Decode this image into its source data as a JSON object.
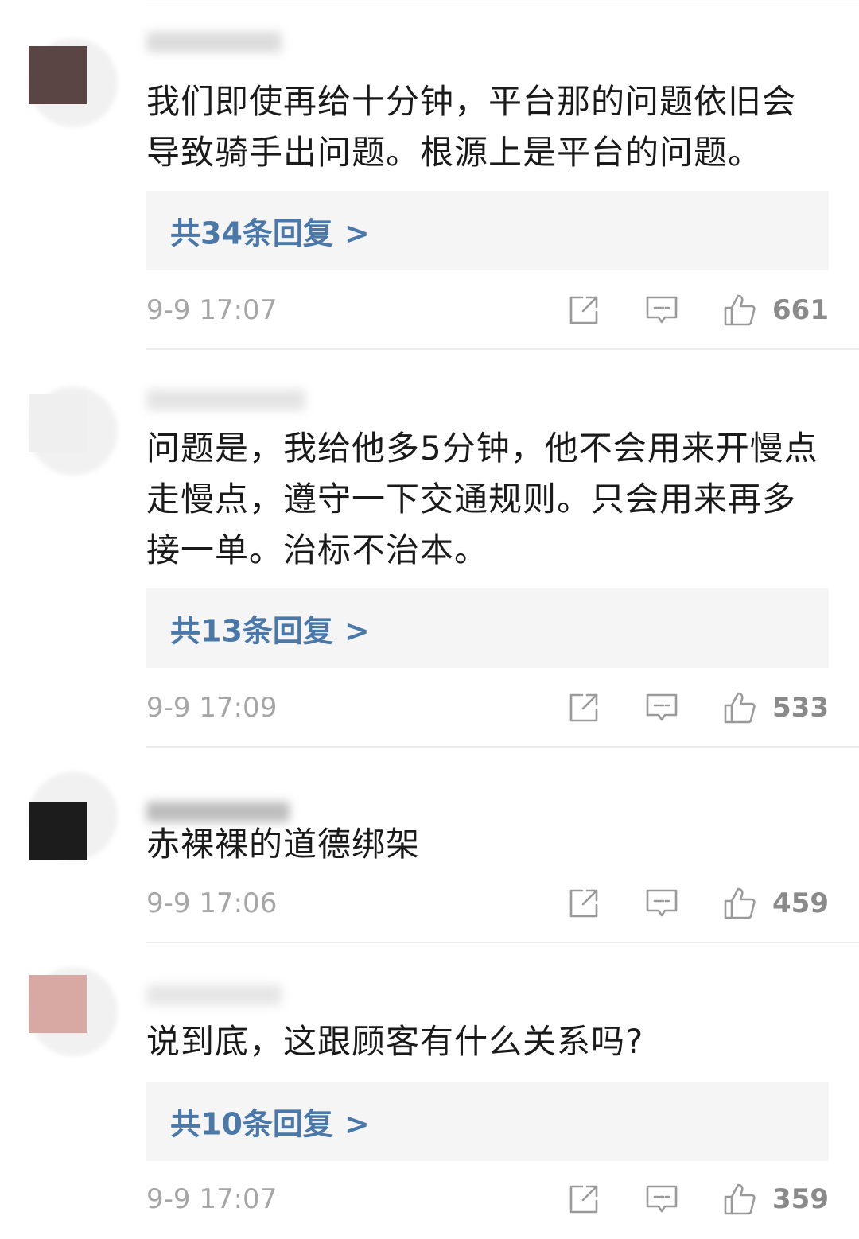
{
  "comments": [
    {
      "text": "我们即使再给十分钟，平台那的问题依旧会导致骑手出问题。根源上是平台的问题。",
      "reply": "共34条回复",
      "reply_arrow": ">",
      "time": "9-9 17:07",
      "likes": "661",
      "avatar_color": "#5a4444"
    },
    {
      "text": "问题是，我给他多5分钟，他不会用来开慢点走慢点，遵守一下交通规则。只会用来再多接一单。治标不治本。",
      "reply": "共13条回复",
      "reply_arrow": ">",
      "time": "9-9 17:09",
      "likes": "533",
      "avatar_color": "#efefef"
    },
    {
      "text": "赤裸裸的道德绑架",
      "time": "9-9 17:06",
      "likes": "459",
      "avatar_color": "#1c1c1c"
    },
    {
      "text": "说到底，这跟顾客有什么关系吗?",
      "reply": "共10条回复",
      "reply_arrow": ">",
      "time": "9-9 17:07",
      "likes": "359",
      "avatar_color": "#d8a8a2"
    }
  ],
  "icons": {
    "share": "share-icon",
    "comment": "comment-icon",
    "like": "thumbs-up-icon"
  },
  "colors": {
    "reply_link": "#4a78a8",
    "timestamp": "#a6a6a6",
    "reply_bg": "#f5f5f5"
  }
}
